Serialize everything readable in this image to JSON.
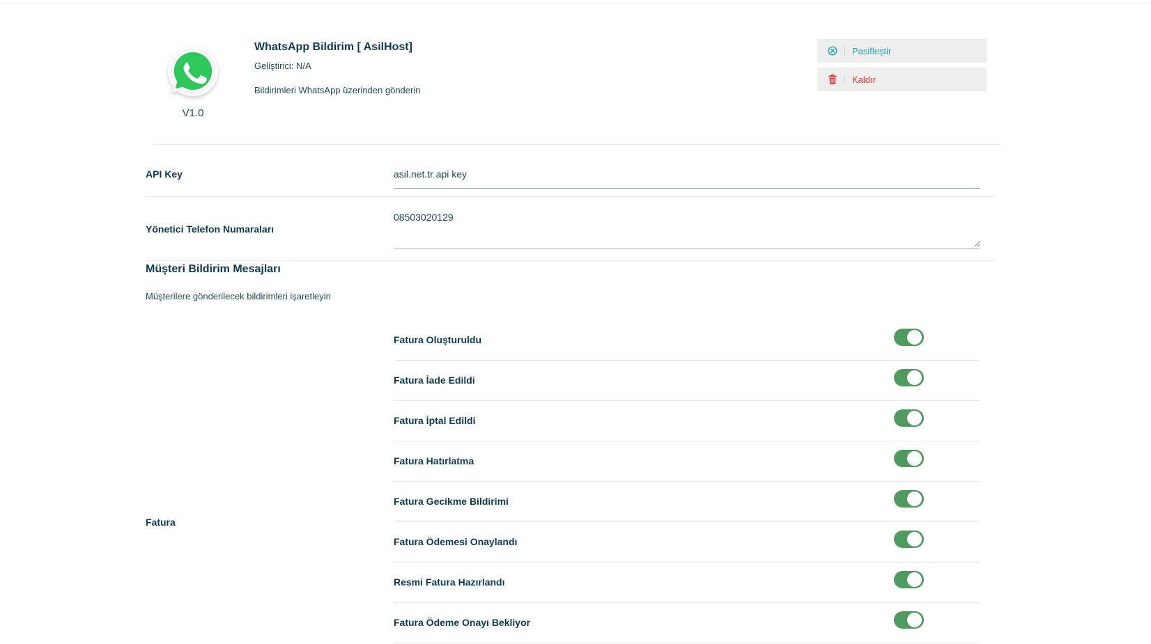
{
  "plugin": {
    "title": "WhatsApp Bildirim [ AsilHost]",
    "developer": "Geliştirici: N/A",
    "description": "Bildirimleri WhatsApp üzerinden gönderin",
    "version": "V1.0",
    "logo_icon": "whatsapp-logo",
    "actions": {
      "deactivate_label": "Pasifleştir",
      "remove_label": "Kaldır"
    }
  },
  "settings": {
    "api_key": {
      "label": "API Key",
      "value": "asil.net.tr api key"
    },
    "admin_phones": {
      "label": "Yönetici Telefon Numaraları",
      "value": "08503020129"
    }
  },
  "customer_notifications": {
    "title": "Müşteri Bildirim Mesajları",
    "subtitle": "Müşterilere gönderilecek bildirimleri işaretleyin",
    "group_label": "Fatura",
    "items": [
      {
        "label": "Fatura Oluşturuldu",
        "enabled": true
      },
      {
        "label": "Fatura İade Edildi",
        "enabled": true
      },
      {
        "label": "Fatura İptal Edildi",
        "enabled": true
      },
      {
        "label": "Fatura Hatırlatma",
        "enabled": true
      },
      {
        "label": "Fatura Gecikme Bildirimi",
        "enabled": true
      },
      {
        "label": "Fatura Ödemesi Onaylandı",
        "enabled": true
      },
      {
        "label": "Resmi Fatura Hazırlandı",
        "enabled": true
      },
      {
        "label": "Fatura Ödeme Onayı Bekliyor",
        "enabled": true
      }
    ]
  },
  "colors": {
    "toggle_on": "#4f9a5e",
    "text_primary": "#0c3a52",
    "deactivate": "#26a9c0",
    "remove": "#e53935",
    "whatsapp_green": "#25d366"
  }
}
